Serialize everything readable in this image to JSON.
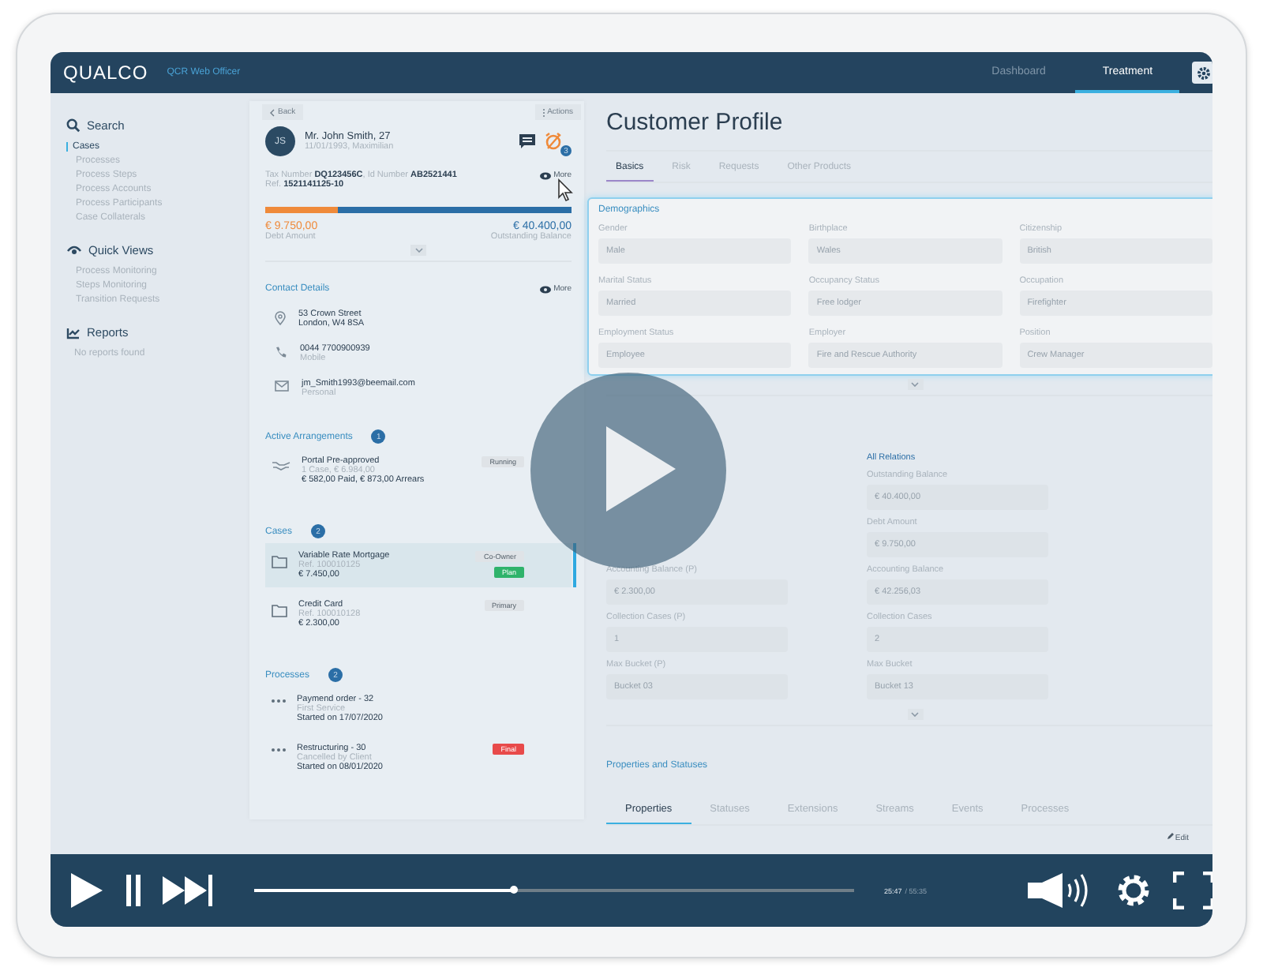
{
  "header": {
    "logo": "QUALCO",
    "app_name": "QCR Web Officer",
    "nav": [
      {
        "label": "Dashboard",
        "selected": false
      },
      {
        "label": "Treatment",
        "selected": true
      }
    ]
  },
  "sidebar": [
    {
      "title": "Search",
      "items": [
        {
          "label": "Cases",
          "selected": true
        },
        {
          "label": "Processes",
          "selected": false
        },
        {
          "label": "Process Steps",
          "selected": false
        },
        {
          "label": "Process Accounts",
          "selected": false
        },
        {
          "label": "Process Participants",
          "selected": false
        },
        {
          "label": "Case Collaterals",
          "selected": false
        }
      ]
    },
    {
      "title": "Quick Views",
      "items": [
        {
          "label": "Process Monitoring",
          "selected": false
        },
        {
          "label": "Steps Monitoring",
          "selected": false
        },
        {
          "label": "Transition Requests",
          "selected": false
        }
      ]
    },
    {
      "title": "Reports",
      "note": "No reports found"
    }
  ],
  "customer": {
    "back": "Back",
    "actions": "Actions",
    "initials": "JS",
    "name": "Mr. John Smith, 27",
    "subtitle": "11/01/1993, Maximilian",
    "alerts": "3",
    "ids": "Tax Number **DQ123456C**, Id Number **AB2521441**",
    "ref": "Ref. **1521141125-10**",
    "more": "More",
    "balance": {
      "level": 0.235,
      "debt": "€ 9.750,00",
      "debt_label": "Debt Amount",
      "outstanding": "€ 40.400,00",
      "outstanding_label": "Outstanding Balance"
    }
  },
  "contact": {
    "title": "Contact Details",
    "more": "More",
    "items": [
      {
        "kind": "address",
        "lines": [
          "53 Crown Street",
          "London, W4 8SA"
        ]
      },
      {
        "kind": "phone",
        "lines": [
          "0044 7700900939",
          "Mobile"
        ]
      },
      {
        "kind": "email",
        "lines": [
          "jm_Smith1993@beemail.com",
          "Personal"
        ]
      }
    ]
  },
  "arrangements": {
    "title": "Active Arrangements",
    "count": "1",
    "items": [
      {
        "title": "Portal Pre-approved",
        "sub": "1 Case, € 6.984,00",
        "detail": "€ 582,00 Paid, € 873,00 Arrears",
        "tags": [
          {
            "label": "Running",
            "color": "#dfe3e7"
          }
        ]
      }
    ]
  },
  "cases": {
    "title": "Cases",
    "count": "2",
    "items": [
      {
        "title": "Variable Rate Mortgage",
        "sub": "Ref. 100010125",
        "detail": "€ 7.450,00",
        "selected": true,
        "tags": [
          {
            "label": "Co-Owner",
            "color": "#dfe3e7"
          },
          {
            "label": "Plan",
            "color": "#2fb36b"
          }
        ]
      },
      {
        "title": "Credit Card",
        "sub": "Ref. 100010128",
        "detail": "€ 2.300,00",
        "selected": false,
        "tags": [
          {
            "label": "Primary",
            "color": "#dfe3e7"
          }
        ]
      }
    ]
  },
  "processes": {
    "title": "Processes",
    "count": "2",
    "items": [
      {
        "title": "Paymend order - 32",
        "sub": "First Service",
        "detail": "Started on 17/07/2020"
      },
      {
        "title": "Restructuring  - 30",
        "sub": "Cancelled by Client",
        "detail": "Started on 08/01/2020",
        "tags": [
          {
            "label": "Final",
            "color": "#e84a4a"
          }
        ]
      }
    ]
  },
  "profile": {
    "title": "Customer Profile",
    "tabs": [
      {
        "label": "Basics",
        "selected": true
      },
      {
        "label": "Risk",
        "selected": false
      },
      {
        "label": "Requests",
        "selected": false
      },
      {
        "label": "Other Products",
        "selected": false
      }
    ],
    "demographics": {
      "title": "Demographics",
      "fields": [
        {
          "label": "Gender",
          "value": "Male"
        },
        {
          "label": "Birthplace",
          "value": "Wales"
        },
        {
          "label": "Citizenship",
          "value": "British"
        },
        {
          "label": "Marital Status",
          "value": "Married"
        },
        {
          "label": "Occupancy Status",
          "value": "Free lodger"
        },
        {
          "label": "Occupation",
          "value": "Firefighter"
        },
        {
          "label": "Employment Status",
          "value": "Employee"
        },
        {
          "label": "Employer",
          "value": "Fire and Rescue Authority"
        },
        {
          "label": "Position",
          "value": "Crew Manager"
        }
      ]
    },
    "totals": {
      "columns": [
        {
          "fields": [
            {
              "label": "Accounting Balance (P)",
              "value": "€ 2.300,00"
            },
            {
              "label": "Collection Cases (P)",
              "value": "1"
            },
            {
              "label": "Max Bucket (P)",
              "value": "Bucket 03"
            }
          ]
        },
        {
          "title": "All Relations",
          "fields": [
            {
              "label": "Outstanding Balance",
              "value": "€ 40.400,00"
            },
            {
              "label": "Debt Amount",
              "value": "€ 9.750,00"
            },
            {
              "label": "Accounting Balance",
              "value": "€ 42.256,03"
            },
            {
              "label": "Collection Cases",
              "value": "2"
            },
            {
              "label": "Max Bucket",
              "value": "Bucket 13"
            }
          ]
        }
      ]
    },
    "properties": {
      "title": "Properties and Statuses",
      "tabs": [
        {
          "label": "Properties",
          "selected": true
        },
        {
          "label": "Statuses",
          "selected": false
        },
        {
          "label": "Extensions",
          "selected": false
        },
        {
          "label": "Streams",
          "selected": false
        },
        {
          "label": "Events",
          "selected": false
        },
        {
          "label": "Processes",
          "selected": false
        }
      ],
      "edit": "Edit"
    }
  },
  "player": {
    "level": 0.435,
    "time": "25:47",
    "duration": "/ 55:35"
  }
}
